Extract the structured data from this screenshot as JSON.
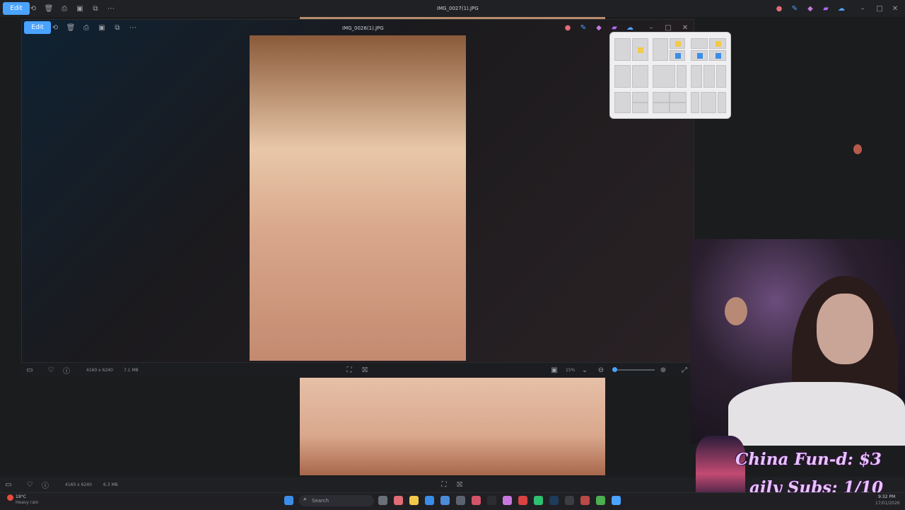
{
  "outer": {
    "edit_label": "Edit",
    "title": "IMG_0027(1).JPG",
    "status": {
      "dimensions": "4160 x 6240",
      "size": "6.3 MB"
    }
  },
  "inner": {
    "edit_label": "Edit",
    "title": "IMG_0026(1).JPG",
    "status": {
      "dimensions": "4160 x 6240",
      "size": "7.1 MB"
    },
    "zoom": "15%"
  },
  "overlay": {
    "line1": "China Fun-d: $3",
    "line2": "aily Subs: 1/10"
  },
  "taskbar": {
    "search_placeholder": "Search",
    "weather_temp": "19°C",
    "weather_desc": "Heavy rain",
    "time": "9:32 PM",
    "date": "17/01/2026"
  },
  "colors": {
    "accent": "#4aa3ff",
    "overlay_text": "#e7c3ff"
  }
}
